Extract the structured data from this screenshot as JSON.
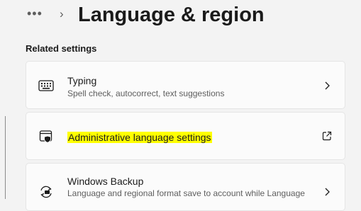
{
  "breadcrumb": {
    "more_glyph": "•••",
    "separator_glyph": "›",
    "title": "Language & region"
  },
  "related": {
    "heading": "Related settings",
    "items": [
      {
        "label": "Typing",
        "description": "Spell check, autocorrect, text suggestions",
        "icon": "keyboard-icon",
        "action_icon": "chevron-right-icon"
      },
      {
        "label": "Administrative language settings",
        "description": "",
        "icon": "admin-window-shield-icon",
        "action_icon": "open-external-icon",
        "highlight_color": "#ffff00"
      },
      {
        "label": "Windows Backup",
        "description": "Language and regional format save to account while Language",
        "icon": "backup-sync-icon",
        "action_icon": "chevron-right-icon"
      }
    ]
  }
}
